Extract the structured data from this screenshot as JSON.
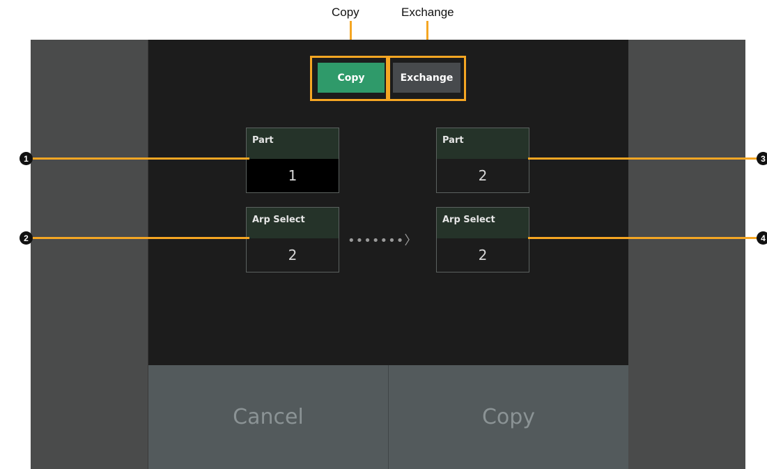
{
  "callouts": {
    "copy": "Copy",
    "exchange": "Exchange"
  },
  "mode_buttons": {
    "copy": "Copy",
    "exchange": "Exchange"
  },
  "source": {
    "part_label": "Part",
    "part_value": "1",
    "arp_label": "Arp Select",
    "arp_value": "2"
  },
  "dest": {
    "part_label": "Part",
    "part_value": "2",
    "arp_label": "Arp Select",
    "arp_value": "2"
  },
  "arrow": "•••••••〉",
  "actions": {
    "cancel": "Cancel",
    "copy": "Copy"
  },
  "markers": [
    "1",
    "2",
    "3",
    "4"
  ],
  "colors": {
    "accent": "#f5a623",
    "active_mode": "#2f9a6a"
  }
}
